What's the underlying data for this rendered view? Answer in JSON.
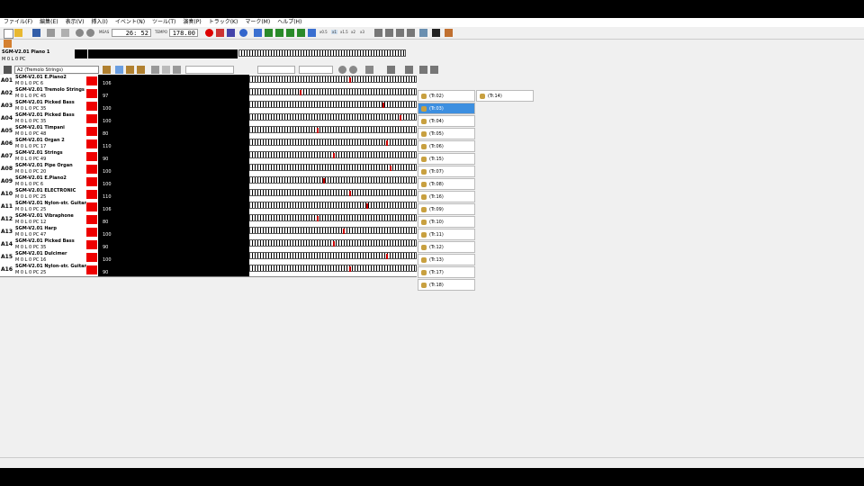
{
  "menu": [
    "ファイル(F)",
    "編集(E)",
    "表示(V)",
    "挿入(I)",
    "イベント(N)",
    "ツール(T)",
    "演奏(P)",
    "トラック(K)",
    "マーク(M)",
    "ヘルプ(H)"
  ],
  "toolbar": {
    "meas_label": "MEAS",
    "counter": "26: 52",
    "tempo_label": "TEMPO",
    "tempo": "178.00",
    "speeds": [
      "x0.5",
      "x1",
      "x1.5",
      "x2",
      "x3"
    ]
  },
  "header_track": {
    "name": "SGM-V2.01 Piano 1",
    "sub": "M 0 L 0 PC",
    "instrument": "A2 (Tremolo Strings)"
  },
  "rows": [
    {
      "id": "A01",
      "name": "SGM-V2.01 E.Piano2",
      "sub": "M 0 L 0 PC 6",
      "vol": "106"
    },
    {
      "id": "A02",
      "name": "SGM-V2.01 Tremolo Strings",
      "sub": "M 0 L 0 PC 45",
      "vol": "97"
    },
    {
      "id": "A03",
      "name": "SGM-V2.01 Picked Bass",
      "sub": "M 0 L 0 PC 35",
      "vol": "100"
    },
    {
      "id": "A04",
      "name": "SGM-V2.01 Picked Bass",
      "sub": "M 0 L 0 PC 35",
      "vol": "100"
    },
    {
      "id": "A05",
      "name": "SGM-V2.01 Timpani",
      "sub": "M 0 L 0 PC 48",
      "vol": "80"
    },
    {
      "id": "A06",
      "name": "SGM-V2.01 Organ 2",
      "sub": "M 0 L 0 PC 17",
      "vol": "110"
    },
    {
      "id": "A07",
      "name": "SGM-V2.01 Strings",
      "sub": "M 0 L 0 PC 49",
      "vol": "90"
    },
    {
      "id": "A08",
      "name": "SGM-V2.01 Pipe Organ",
      "sub": "M 0 L 0 PC 20",
      "vol": "100"
    },
    {
      "id": "A09",
      "name": "SGM-V2.01 E.Piano2",
      "sub": "M 0 L 0 PC 6",
      "vol": "100"
    },
    {
      "id": "A10",
      "name": "SGM-V2.01 ELECTRONIC",
      "sub": "M 0 L 0 PC 25",
      "vol": "110"
    },
    {
      "id": "A11",
      "name": "SGM-V2.01 Nylon-str. Guitar",
      "sub": "M 0 L 0 PC 25",
      "vol": "106"
    },
    {
      "id": "A12",
      "name": "SGM-V2.01 Vibraphone",
      "sub": "M 0 L 0 PC 12",
      "vol": "80"
    },
    {
      "id": "A13",
      "name": "SGM-V2.01 Harp",
      "sub": "M 0 L 0 PC 47",
      "vol": "100"
    },
    {
      "id": "A14",
      "name": "SGM-V2.01 Picked Bass",
      "sub": "M 0 L 0 PC 35",
      "vol": "90"
    },
    {
      "id": "A15",
      "name": "SGM-V2.01 Dulcimer",
      "sub": "M 0 L 0 PC 16",
      "vol": "100"
    },
    {
      "id": "A16",
      "name": "SGM-V2.01 Nylon-str. Guitar",
      "sub": "M 0 L 0 PC 25",
      "vol": "90"
    }
  ],
  "tracks": [
    "(Tr.02)",
    "(Tr.03)",
    "(Tr.04)",
    "(Tr.05)",
    "(Tr.06)",
    "(Tr.15)",
    "(Tr.07)",
    "(Tr.08)",
    "(Tr.16)",
    "(Tr.09)",
    "(Tr.10)",
    "(Tr.11)",
    "(Tr.12)",
    "(Tr.13)",
    "(Tr.17)",
    "(Tr.18)"
  ],
  "extra_track": "(Tr.14)"
}
